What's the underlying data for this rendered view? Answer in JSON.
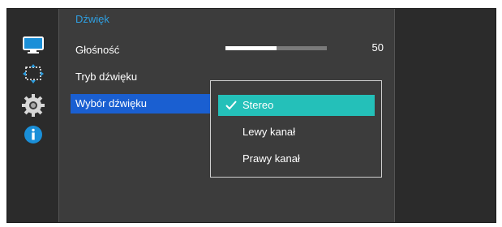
{
  "menu": {
    "title": "Dźwięk",
    "items": [
      {
        "label": "Głośność"
      },
      {
        "label": "Tryb dźwięku"
      },
      {
        "label": "Wybór dźwięku",
        "selected": true
      }
    ]
  },
  "volume": {
    "value": "50",
    "level_percent": 50
  },
  "dropdown": {
    "options": [
      {
        "label": "Stereo",
        "selected": true
      },
      {
        "label": "Lewy kanał"
      },
      {
        "label": "Prawy kanał"
      }
    ]
  },
  "icons": [
    "monitor-icon",
    "screen-adjust-icon",
    "gear-icon",
    "info-icon"
  ],
  "colors": {
    "title": "#2f9fe0",
    "selected_item": "#1a5fd1",
    "selected_option": "#24c0b9"
  }
}
